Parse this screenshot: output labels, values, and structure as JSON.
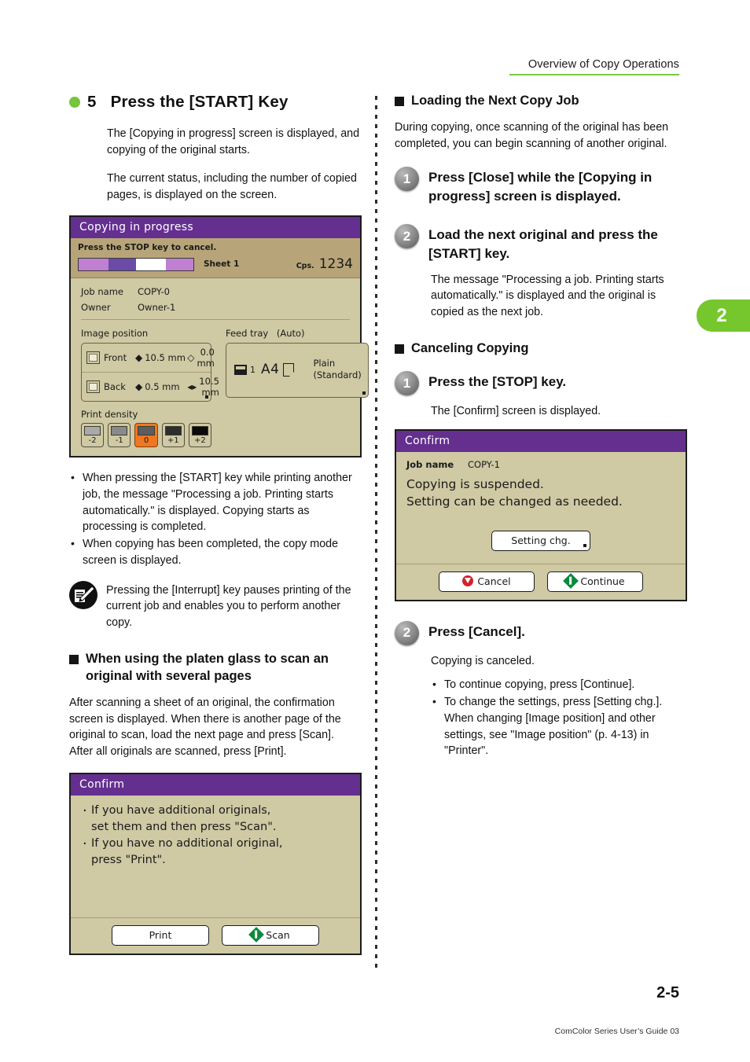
{
  "header": {
    "running_head": "Overview of Copy Operations",
    "rule_color": "#7ac943"
  },
  "chapter_tab": {
    "number": "2",
    "color": "#76c72e"
  },
  "left_column": {
    "step_heading": {
      "number": "5",
      "title": "Press the [START] Key",
      "bullet_color": "#77c53a"
    },
    "paragraphs": [
      "The [Copying in progress] screen is displayed, and copying of the original starts.",
      "The current status, including the number of copied pages, is displayed on the screen."
    ],
    "copying_panel": {
      "title": "Copying in progress",
      "hint": "Press the STOP key to cancel.",
      "sheet_label": "Sheet 1",
      "cps_label": "Cps.",
      "cps_value": "1234",
      "job_name_label": "Job name",
      "job_name_value": "COPY-0",
      "owner_label": "Owner",
      "owner_value": "Owner-1",
      "image_position_label": "Image position",
      "front_label": "Front",
      "front_v": "10.5 mm",
      "front_h": "0.0 mm",
      "back_label": "Back",
      "back_v": "0.5 mm",
      "back_h": "10.5 mm",
      "feed_tray_label": "Feed tray",
      "feed_tray_mode": "(Auto)",
      "tray_number": "1",
      "paper_size": "A4",
      "paper_type_line1": "Plain",
      "paper_type_line2": "(Standard)",
      "print_density_label": "Print density",
      "density_options": [
        "-2",
        "-1",
        "0",
        "+1",
        "+2"
      ],
      "density_selected": "0",
      "selected_color": "#ef7722",
      "title_bar_color": "#642f8f",
      "panel_bg": "#cfc9a4"
    },
    "bullets": [
      "When pressing the [START] key while printing another job, the message \"Processing a job. Printing starts automatically.\" is displayed. Copying starts as processing is completed.",
      "When copying has been completed, the copy mode screen is displayed."
    ],
    "note": {
      "icon": "note-pencil-icon",
      "text": "Pressing the [Interrupt] key pauses printing of the current job and enables you to perform another copy."
    },
    "platen_section": {
      "heading": "When using the platen glass to scan an original with several pages",
      "text": "After scanning a sheet of an original, the confirmation screen is displayed. When there is another page of the original to scan, load the next page and press [Scan].\nAfter all originals are scanned, press [Print]."
    },
    "confirm_panel": {
      "title": "Confirm",
      "bullet1_line1": "If you have additional originals,",
      "bullet1_line2": "set them and then press \"Scan\".",
      "bullet2_line1": "If you have no additional original,",
      "bullet2_line2": "press \"Print\".",
      "print_button": "Print",
      "scan_button": "Scan"
    }
  },
  "right_column": {
    "loading_section": {
      "heading": "Loading the Next Copy Job",
      "intro": "During copying, once scanning of the original has been completed, you can begin scanning of another original.",
      "steps": [
        {
          "number": "1",
          "title": "Press [Close] while the [Copying in progress] screen is displayed.",
          "desc": ""
        },
        {
          "number": "2",
          "title": "Load the next original and press the [START] key.",
          "desc": "The message \"Processing a job. Printing starts automatically.\" is displayed and the original is copied as the next job."
        }
      ]
    },
    "canceling_section": {
      "heading": "Canceling Copying",
      "step1": {
        "number": "1",
        "title": "Press the [STOP] key.",
        "desc": "The [Confirm] screen is displayed."
      },
      "confirm_panel": {
        "title": "Confirm",
        "job_name_label": "Job name",
        "job_name_value": "COPY-1",
        "line1": "Copying is suspended.",
        "line2": "Setting can be changed as needed.",
        "setting_button": "Setting chg.",
        "cancel_button": "Cancel",
        "continue_button": "Continue"
      },
      "step2": {
        "number": "2",
        "title": "Press [Cancel].",
        "desc": "Copying is canceled.",
        "bullets": [
          "To continue copying, press [Continue].",
          "To change the settings, press [Setting chg.]. When changing [Image position] and other settings, see \"Image position\" (p. 4-13) in \"Printer\"."
        ]
      }
    }
  },
  "footer": {
    "page_number": "2-5",
    "colophon": "ComColor Series User’s Guide 03"
  }
}
